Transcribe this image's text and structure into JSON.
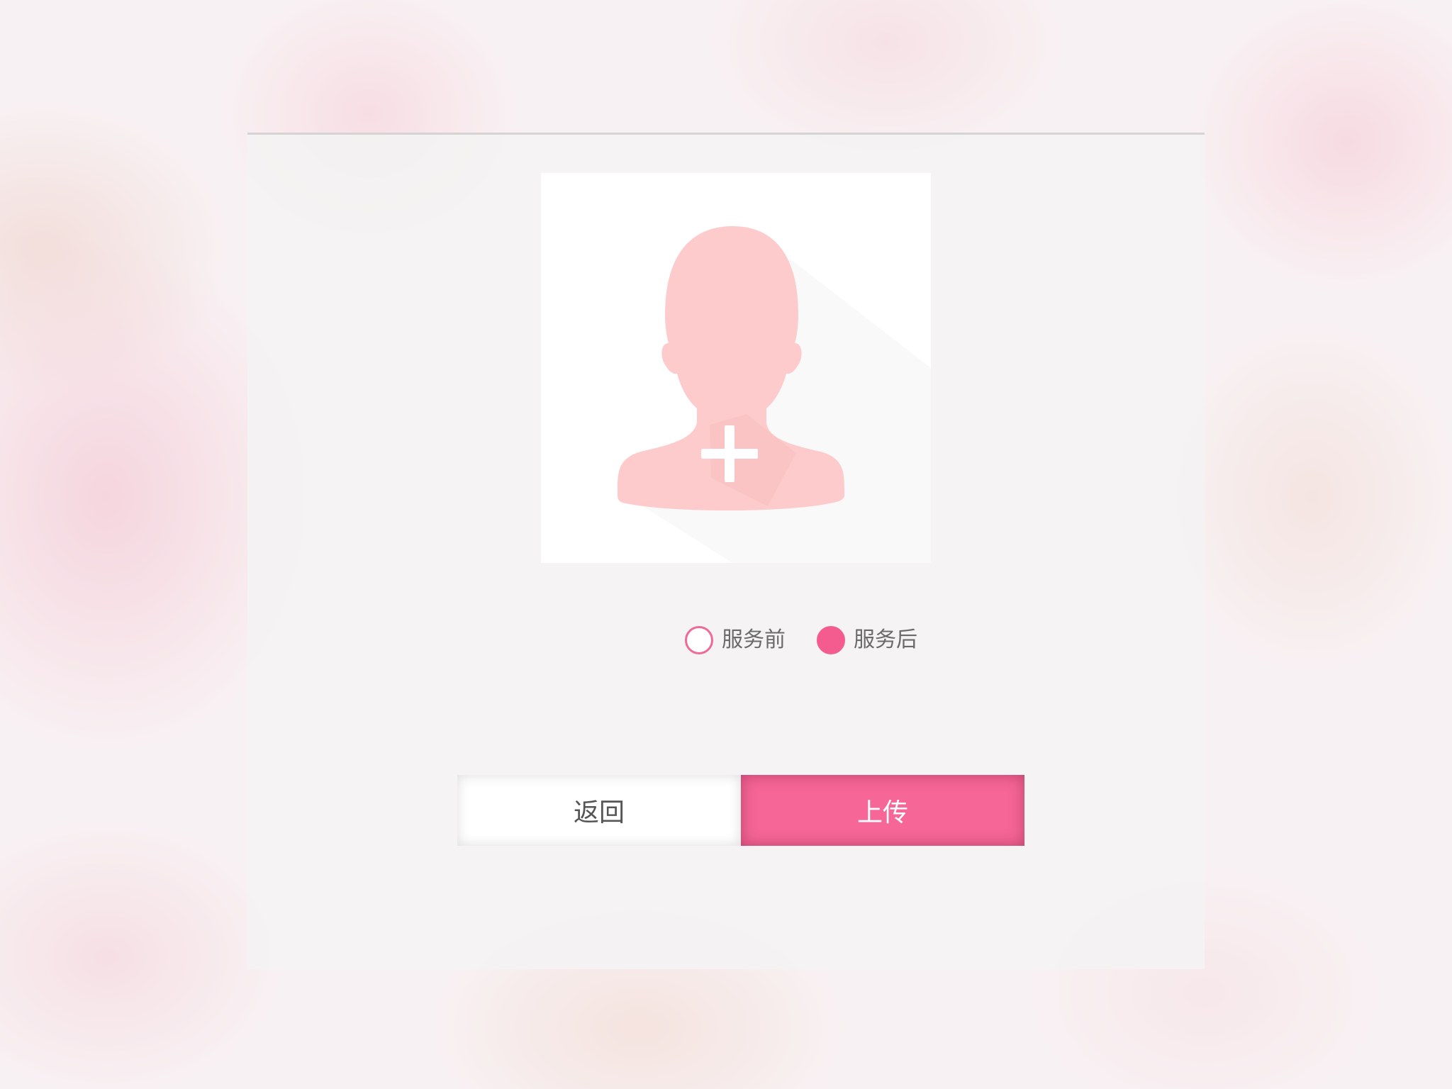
{
  "dialog": {
    "avatar_placeholder": {
      "icon": "person-add-icon",
      "silhouette_color": "#fdcbcb"
    },
    "photo_type": {
      "options": [
        {
          "label": "服务前",
          "checked": false
        },
        {
          "label": "服务后",
          "checked": true
        }
      ],
      "accent_color": "#f45c8f"
    },
    "buttons": {
      "back_label": "返回",
      "upload_label": "上传",
      "upload_color": "#f66696"
    }
  }
}
